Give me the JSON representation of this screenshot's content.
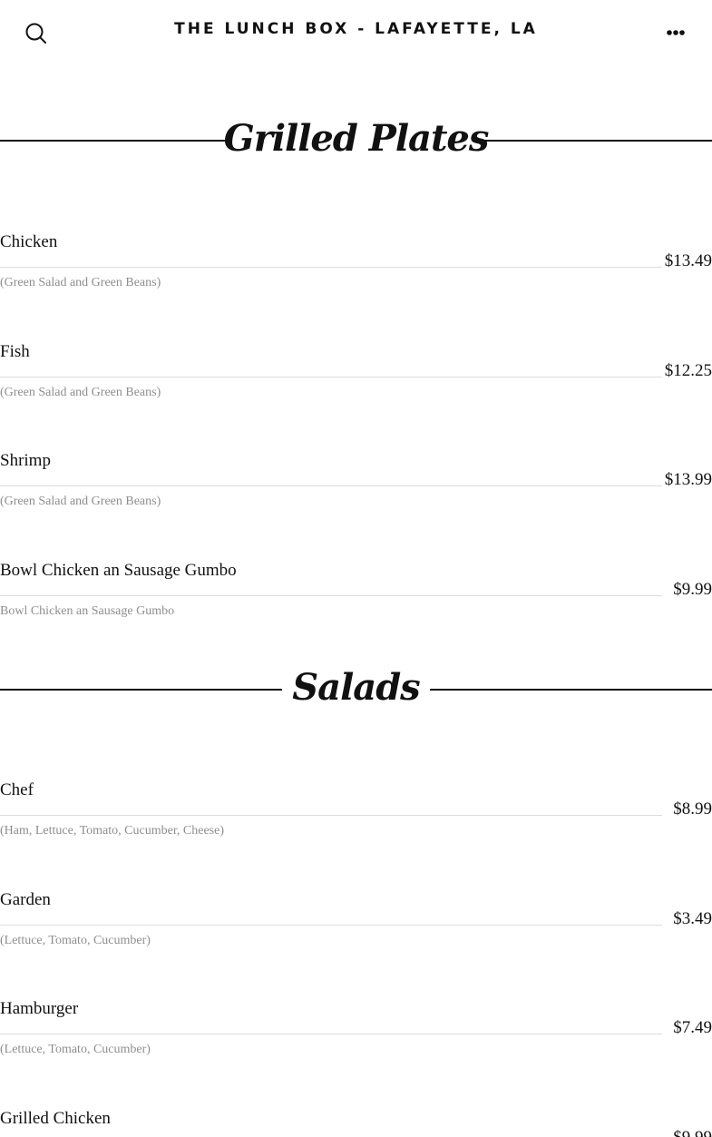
{
  "header": {
    "title": "THE LUNCH BOX - LAFAYETTE, LA",
    "search_icon": "search-icon",
    "menu_icon": "ellipsis-icon"
  },
  "sections": [
    {
      "title": "Grilled Plates",
      "items": [
        {
          "name": "Chicken",
          "price": "$13.49",
          "description": "(Green Salad and Green Beans)"
        },
        {
          "name": "Fish",
          "price": "$12.25",
          "description": "(Green Salad and Green Beans)"
        },
        {
          "name": "Shrimp",
          "price": "$13.99",
          "description": "(Green Salad and Green Beans)"
        },
        {
          "name": "Bowl Chicken an Sausage Gumbo",
          "price": "$9.99",
          "description": "Bowl Chicken an Sausage Gumbo"
        }
      ]
    },
    {
      "title": "Salads",
      "items": [
        {
          "name": "Chef",
          "price": "$8.99",
          "description": "(Ham, Lettuce, Tomato, Cucumber, Cheese)"
        },
        {
          "name": "Garden",
          "price": "$3.49",
          "description": "(Lettuce, Tomato, Cucumber)"
        },
        {
          "name": "Hamburger",
          "price": "$7.49",
          "description": "(Lettuce, Tomato, Cucumber)"
        },
        {
          "name": "Grilled Chicken",
          "price": "$9.99",
          "description": ""
        }
      ]
    }
  ]
}
